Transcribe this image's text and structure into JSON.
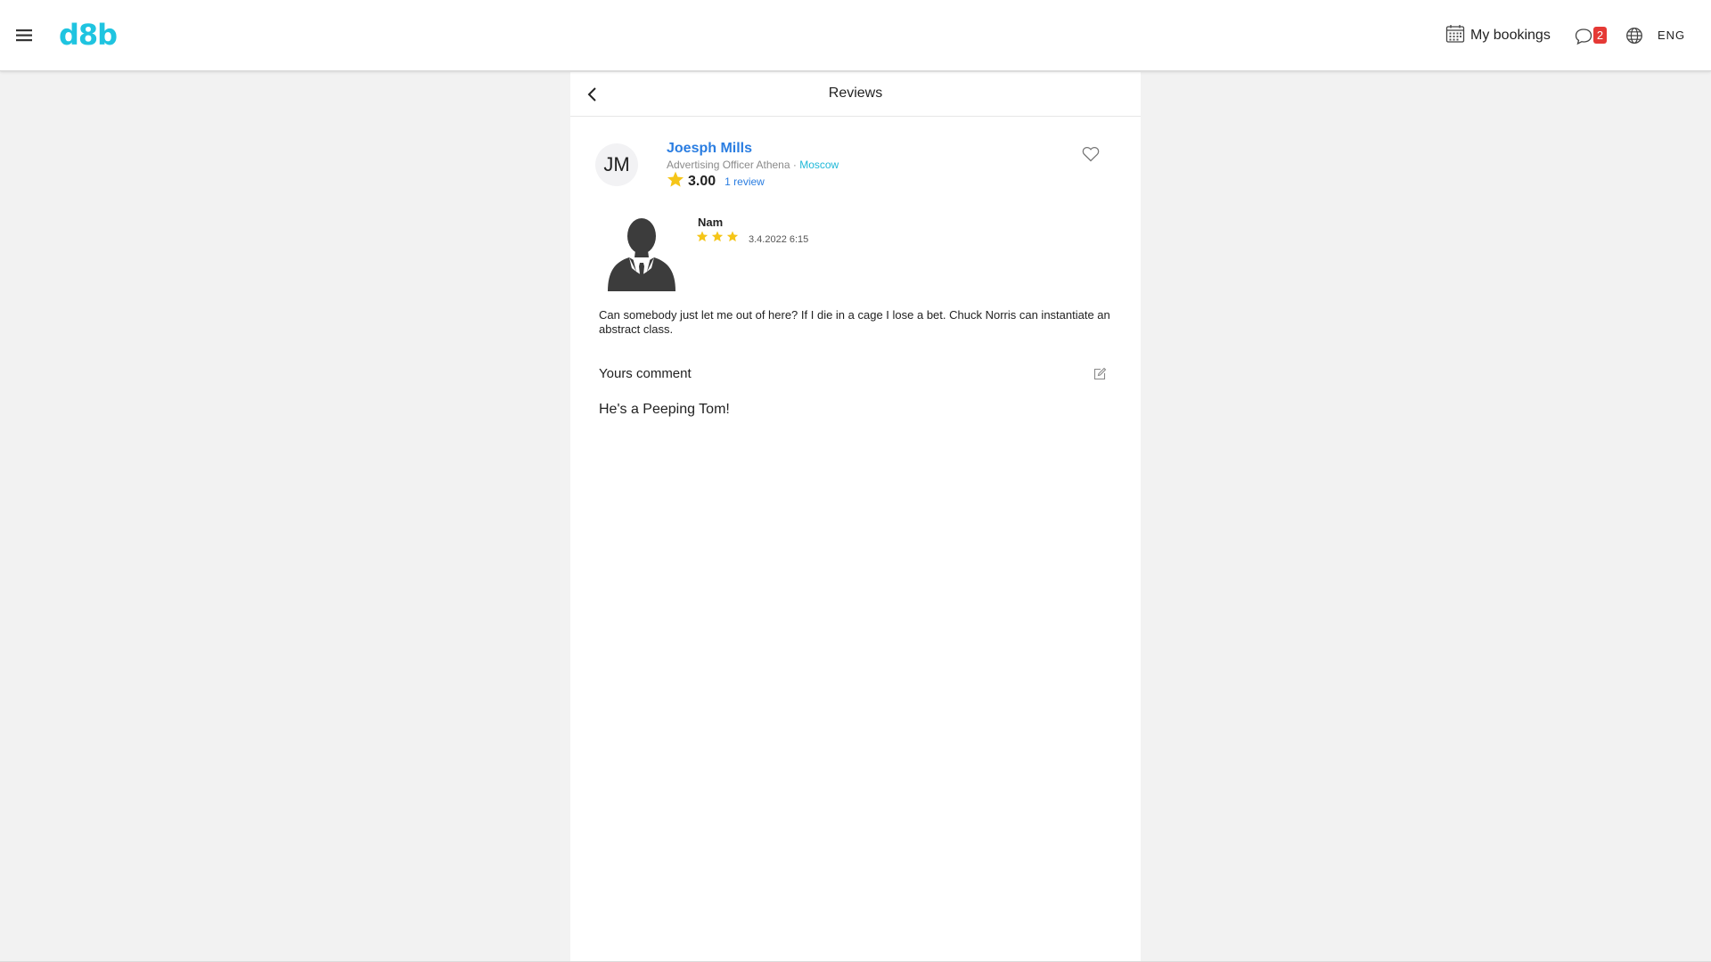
{
  "header": {
    "logo_text": "d8b",
    "bookings_label": "My bookings",
    "chat_badge_count": "2",
    "language": "ENG",
    "icons": {
      "menu": "hamburger-menu-icon",
      "bookings": "calendar-icon",
      "chat": "chat-icon",
      "globe": "globe-icon"
    },
    "colors": {
      "brand": "#1fc4e0",
      "badge": "#e53935"
    }
  },
  "panel": {
    "title": "Reviews",
    "back_icon": "chevron-left-icon"
  },
  "profile": {
    "initials": "JM",
    "name": "Joesph Mills",
    "position": "Advertising Officer Athena",
    "separator": " · ",
    "city": "Moscow",
    "rating": "3.00",
    "review_count": "1 review",
    "favorite_icon": "heart-icon",
    "colors": {
      "name": "#2a7de1",
      "city": "#1fb8d8",
      "star": "#f5c518"
    }
  },
  "review": {
    "reviewer_name": "Nam",
    "stars": 3,
    "date": "3.4.2022 6:15",
    "text": "Can somebody just let me out of here? If I die in a cage I lose a bet. Chuck Norris can instantiate an abstract class."
  },
  "comment": {
    "label": "Yours comment",
    "edit_icon": "edit-icon",
    "text": "He's a Peeping Tom!"
  }
}
